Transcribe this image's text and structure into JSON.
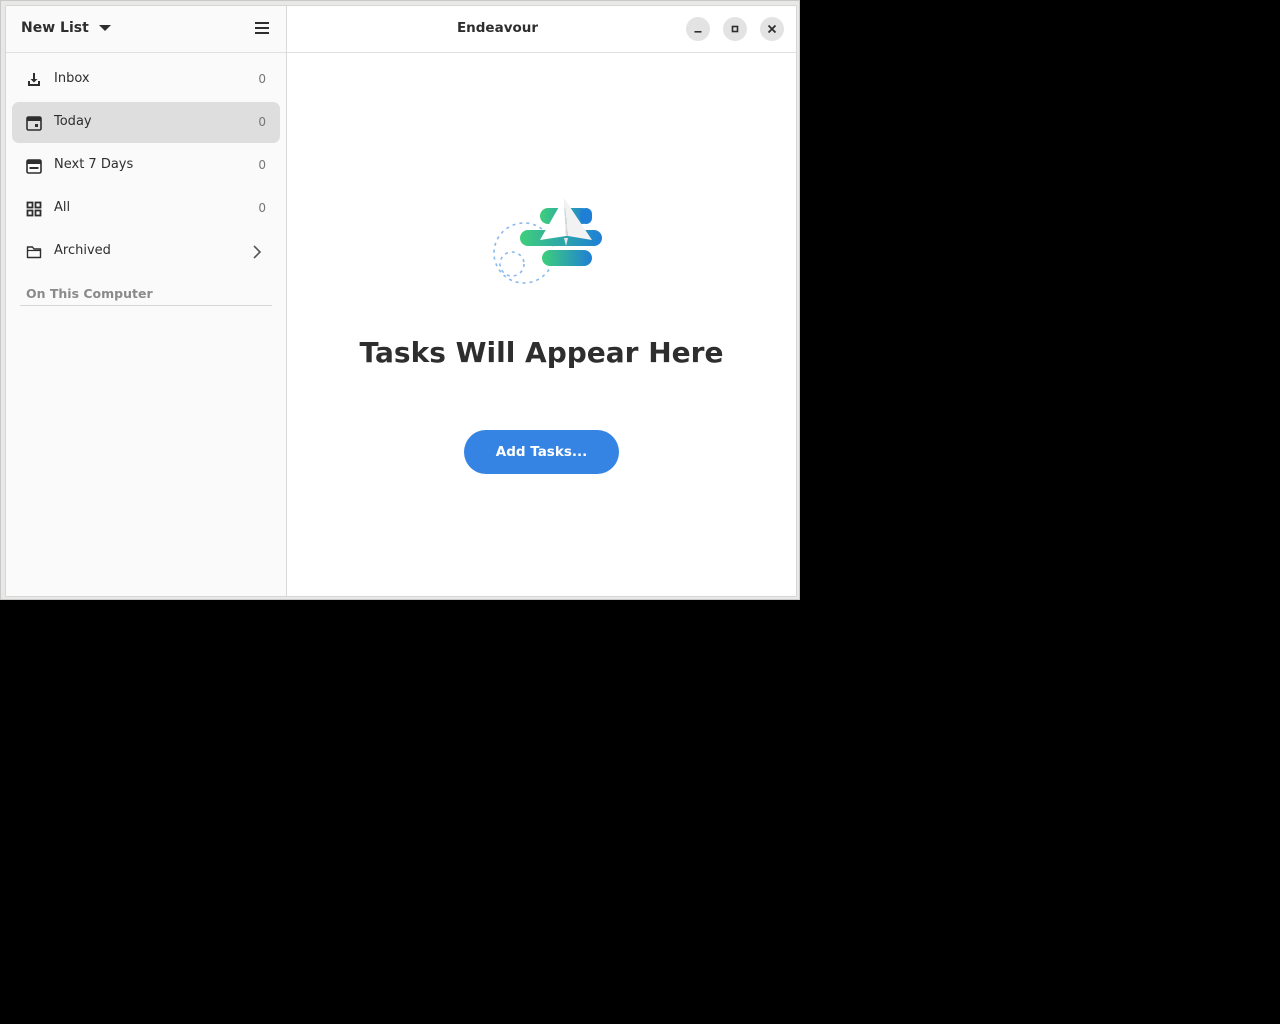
{
  "window": {
    "title": "Endeavour"
  },
  "sidebar": {
    "list_switcher_label": "New List",
    "menu_icon": "hamburger-menu-icon",
    "items": [
      {
        "label": "Inbox",
        "count": "0",
        "icon": "inbox-download-icon",
        "selected": false
      },
      {
        "label": "Today",
        "count": "0",
        "icon": "calendar-today-icon",
        "selected": true
      },
      {
        "label": "Next 7 Days",
        "count": "0",
        "icon": "calendar-week-icon",
        "selected": false
      },
      {
        "label": "All",
        "count": "0",
        "icon": "grid-icon",
        "selected": false
      },
      {
        "label": "Archived",
        "count": "",
        "icon": "folder-icon",
        "selected": false,
        "chevron": "chevron-right-icon"
      }
    ],
    "section_title": "On This Computer"
  },
  "main": {
    "empty_title": "Tasks Will Appear Here",
    "add_button_label": "Add Tasks..."
  },
  "colors": {
    "accent": "#3584e4",
    "art_green": "#3ecf7a",
    "art_blue": "#1f7fd6",
    "selected_bg": "#dedede"
  }
}
